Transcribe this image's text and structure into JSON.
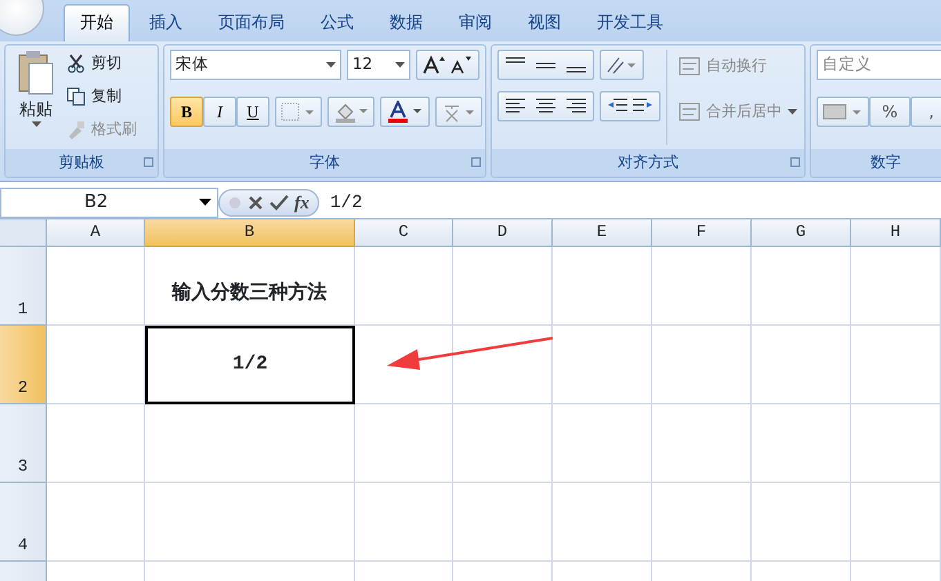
{
  "tabs": [
    {
      "label": "开始",
      "selected": true
    },
    {
      "label": "插入",
      "selected": false
    },
    {
      "label": "页面布局",
      "selected": false
    },
    {
      "label": "公式",
      "selected": false
    },
    {
      "label": "数据",
      "selected": false
    },
    {
      "label": "审阅",
      "selected": false
    },
    {
      "label": "视图",
      "selected": false
    },
    {
      "label": "开发工具",
      "selected": false
    }
  ],
  "clipboard": {
    "paste": "粘贴",
    "items": [
      {
        "label": "剪切",
        "disabled": false
      },
      {
        "label": "复制",
        "disabled": false
      },
      {
        "label": "格式刷",
        "disabled": true
      }
    ],
    "title": "剪贴板"
  },
  "font": {
    "font_name": "宋体",
    "font_size": "12",
    "styles": [
      {
        "label": "B",
        "selected": true
      },
      {
        "label": "I",
        "selected": false
      },
      {
        "label": "U",
        "selected": false
      }
    ],
    "title": "字体"
  },
  "alignment": {
    "commands": [
      {
        "label": "自动换行",
        "disabled": true
      },
      {
        "label": "合并后居中",
        "disabled": true
      }
    ],
    "title": "对齐方式"
  },
  "number": {
    "format": "自定义",
    "symbols": [
      "%",
      ","
    ],
    "title": "数字"
  },
  "formula_bar": {
    "name_box": "B2",
    "fx": "fx",
    "content": "1/2"
  },
  "columns": [
    {
      "label": "A",
      "selected": false
    },
    {
      "label": "B",
      "selected": true
    },
    {
      "label": "C",
      "selected": false
    },
    {
      "label": "D",
      "selected": false
    },
    {
      "label": "E",
      "selected": false
    },
    {
      "label": "F",
      "selected": false
    },
    {
      "label": "G",
      "selected": false
    },
    {
      "label": "H",
      "selected": false
    }
  ],
  "rows": [
    {
      "label": "1",
      "selected": false,
      "cells": [
        "",
        "输入分数三种方法",
        "",
        "",
        "",
        "",
        "",
        ""
      ]
    },
    {
      "label": "2",
      "selected": true,
      "cells": [
        "",
        "1/2",
        "",
        "",
        "",
        "",
        "",
        ""
      ]
    },
    {
      "label": "3",
      "selected": false,
      "cells": [
        "",
        "",
        "",
        "",
        "",
        "",
        "",
        ""
      ]
    },
    {
      "label": "4",
      "selected": false,
      "cells": [
        "",
        "",
        "",
        "",
        "",
        "",
        "",
        ""
      ]
    }
  ]
}
